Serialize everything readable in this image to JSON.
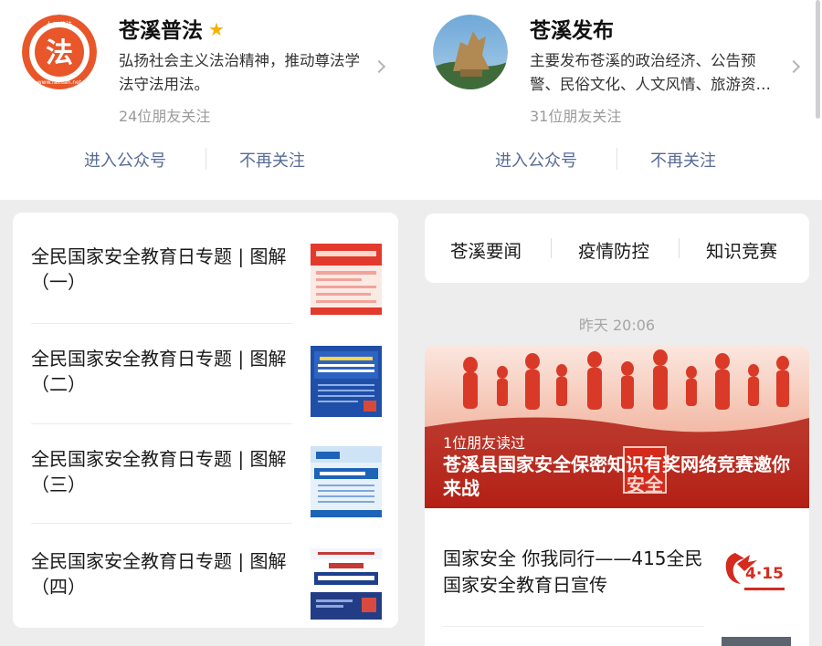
{
  "accounts": [
    {
      "name": "苍溪普法",
      "starred": true,
      "description": "弘扬社会主义法治精神，推动尊法学法守法用法。",
      "followers": "24位朋友关注",
      "enter_label": "进入公众号",
      "unfollow_label": "不再关注",
      "avatar_badge": "七五普法",
      "avatar_char": "法",
      "avatar_url_text": "www.faxuan.net"
    },
    {
      "name": "苍溪发布",
      "starred": false,
      "description": "主要发布苍溪的政治经济、公告预警、民俗文化、人文风情、旅游资…",
      "followers": "31位朋友关注",
      "enter_label": "进入公众号",
      "unfollow_label": "不再关注"
    }
  ],
  "articles": [
    {
      "title": "全民国家安全教育日专题 | 图解（一）"
    },
    {
      "title": "全民国家安全教育日专题 | 图解（二）",
      "thumb_text": "一图读懂《中华人民共和国国防法》中关于维护国家安全的规定"
    },
    {
      "title": "全民国家安全教育日专题 | 图解（三）",
      "thumb_text": "一图读懂 国家安全法（一）"
    },
    {
      "title": "全民国家安全教育日专题 | 图解（四）",
      "thumb_text": "一图读懂《中华人民共和国反间谍法》"
    }
  ],
  "menu": [
    "苍溪要闻",
    "疫情防控",
    "知识竞赛"
  ],
  "feed": {
    "time": "昨天 20:06",
    "hero_read": "1位朋友读过",
    "hero_title": "苍溪县国家安全保密知识有奖网络竞赛邀你来战",
    "hero_sign_text": "安全",
    "sub_title": "国家安全 你我同行——415全民国家安全教育日宣传",
    "sub_thumb_text": "4·15"
  },
  "colors": {
    "link": "#576b95",
    "star": "#f5b300",
    "avatar_orange": "#e8562a"
  }
}
